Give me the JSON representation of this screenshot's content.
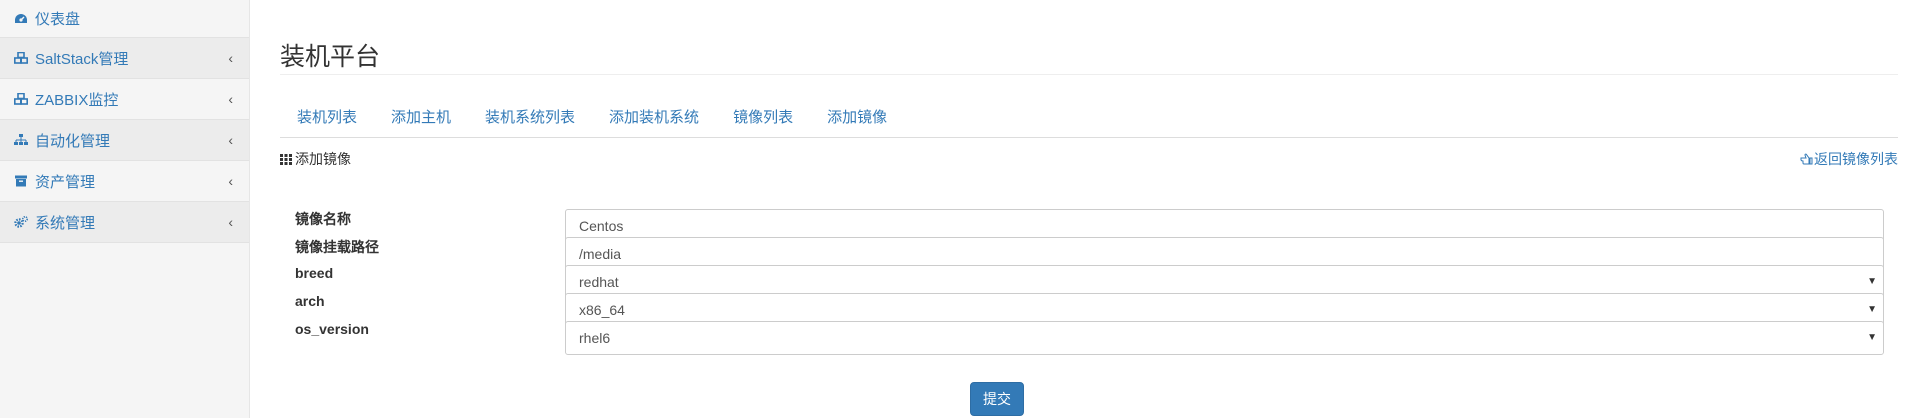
{
  "sidebar": {
    "items": [
      {
        "label": "仪表盘",
        "icon": "dashboard-icon",
        "has_submenu": false
      },
      {
        "label": "SaltStack管理",
        "icon": "cubes-icon",
        "has_submenu": true
      },
      {
        "label": "ZABBIX监控",
        "icon": "cubes-icon",
        "has_submenu": true
      },
      {
        "label": "自动化管理",
        "icon": "sitemap-icon",
        "has_submenu": true
      },
      {
        "label": "资产管理",
        "icon": "archive-icon",
        "has_submenu": true
      },
      {
        "label": "系统管理",
        "icon": "gears-icon",
        "has_submenu": true
      }
    ]
  },
  "main": {
    "title": "装机平台",
    "tabs": [
      {
        "label": "装机列表"
      },
      {
        "label": "添加主机"
      },
      {
        "label": "装机系统列表"
      },
      {
        "label": "添加装机系统"
      },
      {
        "label": "镜像列表"
      },
      {
        "label": "添加镜像"
      }
    ],
    "panel": {
      "title": "添加镜像",
      "title_icon": "th-icon",
      "back_link": "返回镜像列表",
      "back_icon": "hand-left-icon"
    },
    "form": {
      "fields": [
        {
          "label": "镜像名称",
          "type": "input",
          "value": "Centos"
        },
        {
          "label": "镜像挂载路径",
          "type": "input",
          "value": "/media"
        },
        {
          "label": "breed",
          "type": "select",
          "value": "redhat"
        },
        {
          "label": "arch",
          "type": "select",
          "value": "x86_64"
        },
        {
          "label": "os_version",
          "type": "select",
          "value": "rhel6"
        }
      ],
      "submit_label": "提交"
    }
  },
  "colors": {
    "link": "#337ab7",
    "primary_button": "#337ab7",
    "sidebar_bg": "#f5f5f5"
  }
}
